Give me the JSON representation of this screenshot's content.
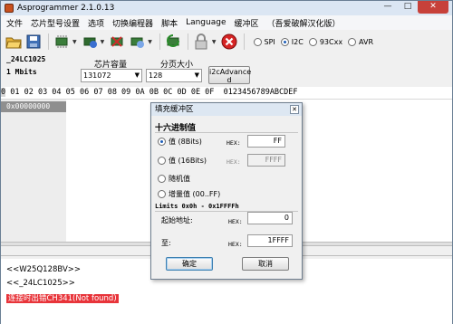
{
  "window": {
    "title": "Asprogrammer 2.1.0.13",
    "min": "—",
    "max": "□",
    "close": "✕"
  },
  "menu": [
    "文件",
    "芯片型号设置",
    "选项",
    "切换编程器",
    "脚本",
    "Language",
    "缓冲区",
    "（吾爱破解汉化版）"
  ],
  "toolbar": {
    "icons": [
      "open-folder-icon",
      "save-icon",
      "read-chip-icon",
      "write-chip-icon",
      "erase-chip-icon",
      "verify-chip-icon",
      "refresh-icon",
      "lock-icon",
      "stop-icon"
    ],
    "protocols": [
      {
        "label": "SPI",
        "selected": false
      },
      {
        "label": "I2C",
        "selected": true
      },
      {
        "label": "93Cxx",
        "selected": false
      },
      {
        "label": "AVR",
        "selected": false
      }
    ]
  },
  "chip": {
    "name": "_24LC1025",
    "size": "1 Mbits"
  },
  "settings": {
    "capacity_label": "芯片容量",
    "capacity_value": "131072",
    "page_label": "分页大小",
    "page_value": "128",
    "i2c_button": "i2cAdvance d"
  },
  "hex": {
    "header_first": "0",
    "header_rest": " 01 02 03 04 05 06 07 08 09 0A 0B 0C 0D 0E 0F  0123456789ABCDEF",
    "address": "0x00000000"
  },
  "log": {
    "lines": [
      "<<W25Q128BV>>",
      "<<_24LC1025>>"
    ],
    "error": "连接时出错CH341(Not found)"
  },
  "dialog": {
    "title": "填充缓冲区",
    "close": "✕",
    "section": "十六进制值",
    "options": [
      {
        "label": "值 (8Bits)",
        "selected": true
      },
      {
        "label": "值 (16Bits)",
        "selected": false
      },
      {
        "label": "随机值",
        "selected": false
      },
      {
        "label": "增量值 (00..FF)",
        "selected": false
      }
    ],
    "hex_label": "HEX:",
    "value8": "FF",
    "value16": "FFFF",
    "limits": "Limits 0x0h - 0x1FFFFh",
    "start_label": "起始地址:",
    "start_value": "0",
    "to_label": "至:",
    "end_value": "1FFFF",
    "ok": "确定",
    "cancel": "取消"
  },
  "colors": {
    "accent": "#1c5db8",
    "error_bg": "#e8343a",
    "addr_bg": "#8f8f8f"
  }
}
